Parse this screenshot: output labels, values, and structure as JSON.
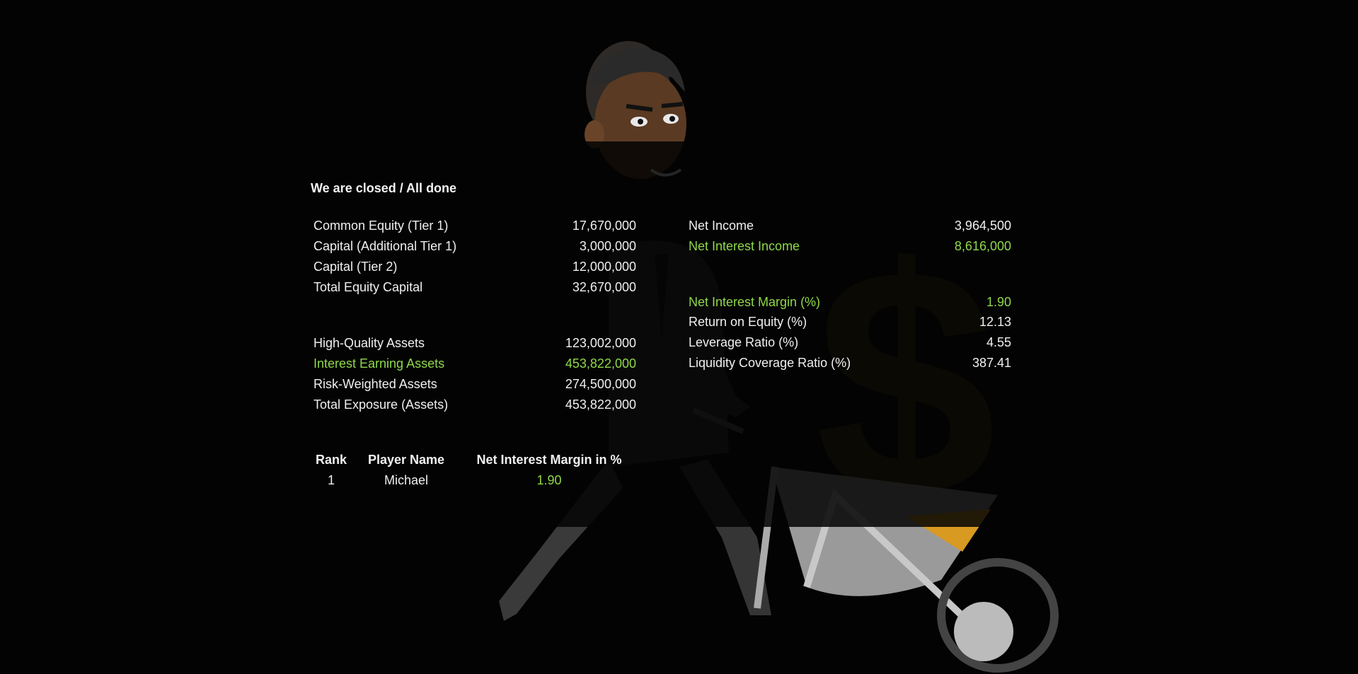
{
  "title": "We are closed / All done",
  "left_column": [
    {
      "label": "Common Equity (Tier 1)",
      "value": "17,670,000",
      "highlight": false
    },
    {
      "label": "Capital (Additional Tier 1)",
      "value": "3,000,000",
      "highlight": false
    },
    {
      "label": "Capital (Tier 2)",
      "value": "12,000,000",
      "highlight": false
    },
    {
      "label": "Total Equity Capital",
      "value": "32,670,000",
      "highlight": false
    },
    {
      "label": "High-Quality Assets",
      "value": "123,002,000",
      "highlight": false
    },
    {
      "label": "Interest Earning Assets",
      "value": "453,822,000",
      "highlight": true
    },
    {
      "label": "Risk-Weighted Assets",
      "value": "274,500,000",
      "highlight": false
    },
    {
      "label": "Total Exposure (Assets)",
      "value": "453,822,000",
      "highlight": false
    }
  ],
  "right_column": [
    {
      "label": "Net Income",
      "value": "3,964,500",
      "highlight": false
    },
    {
      "label": "Net Interest Income",
      "value": "8,616,000",
      "highlight": true
    },
    {
      "label": "Net Interest Margin (%)",
      "value": "1.90",
      "highlight": true
    },
    {
      "label": "Return on Equity (%)",
      "value": "12.13",
      "highlight": false
    },
    {
      "label": "Leverage Ratio (%)",
      "value": "4.55",
      "highlight": false
    },
    {
      "label": "Liquidity Coverage Ratio (%)",
      "value": "387.41",
      "highlight": false
    }
  ],
  "leaderboard": {
    "headers": {
      "rank": "Rank",
      "player": "Player Name",
      "metric": "Net Interest Margin in %"
    },
    "rows": [
      {
        "rank": "1",
        "player": "Michael",
        "metric": "1.90"
      }
    ]
  },
  "background_icons": [
    "businessman-icon",
    "dollar-sign-icon",
    "wheelbarrow-icon"
  ],
  "colors": {
    "background": "#030303",
    "text": "#f0f0f0",
    "highlight": "#8fd84a",
    "dollar": "#3a2e05",
    "gold": "#d89a20"
  }
}
